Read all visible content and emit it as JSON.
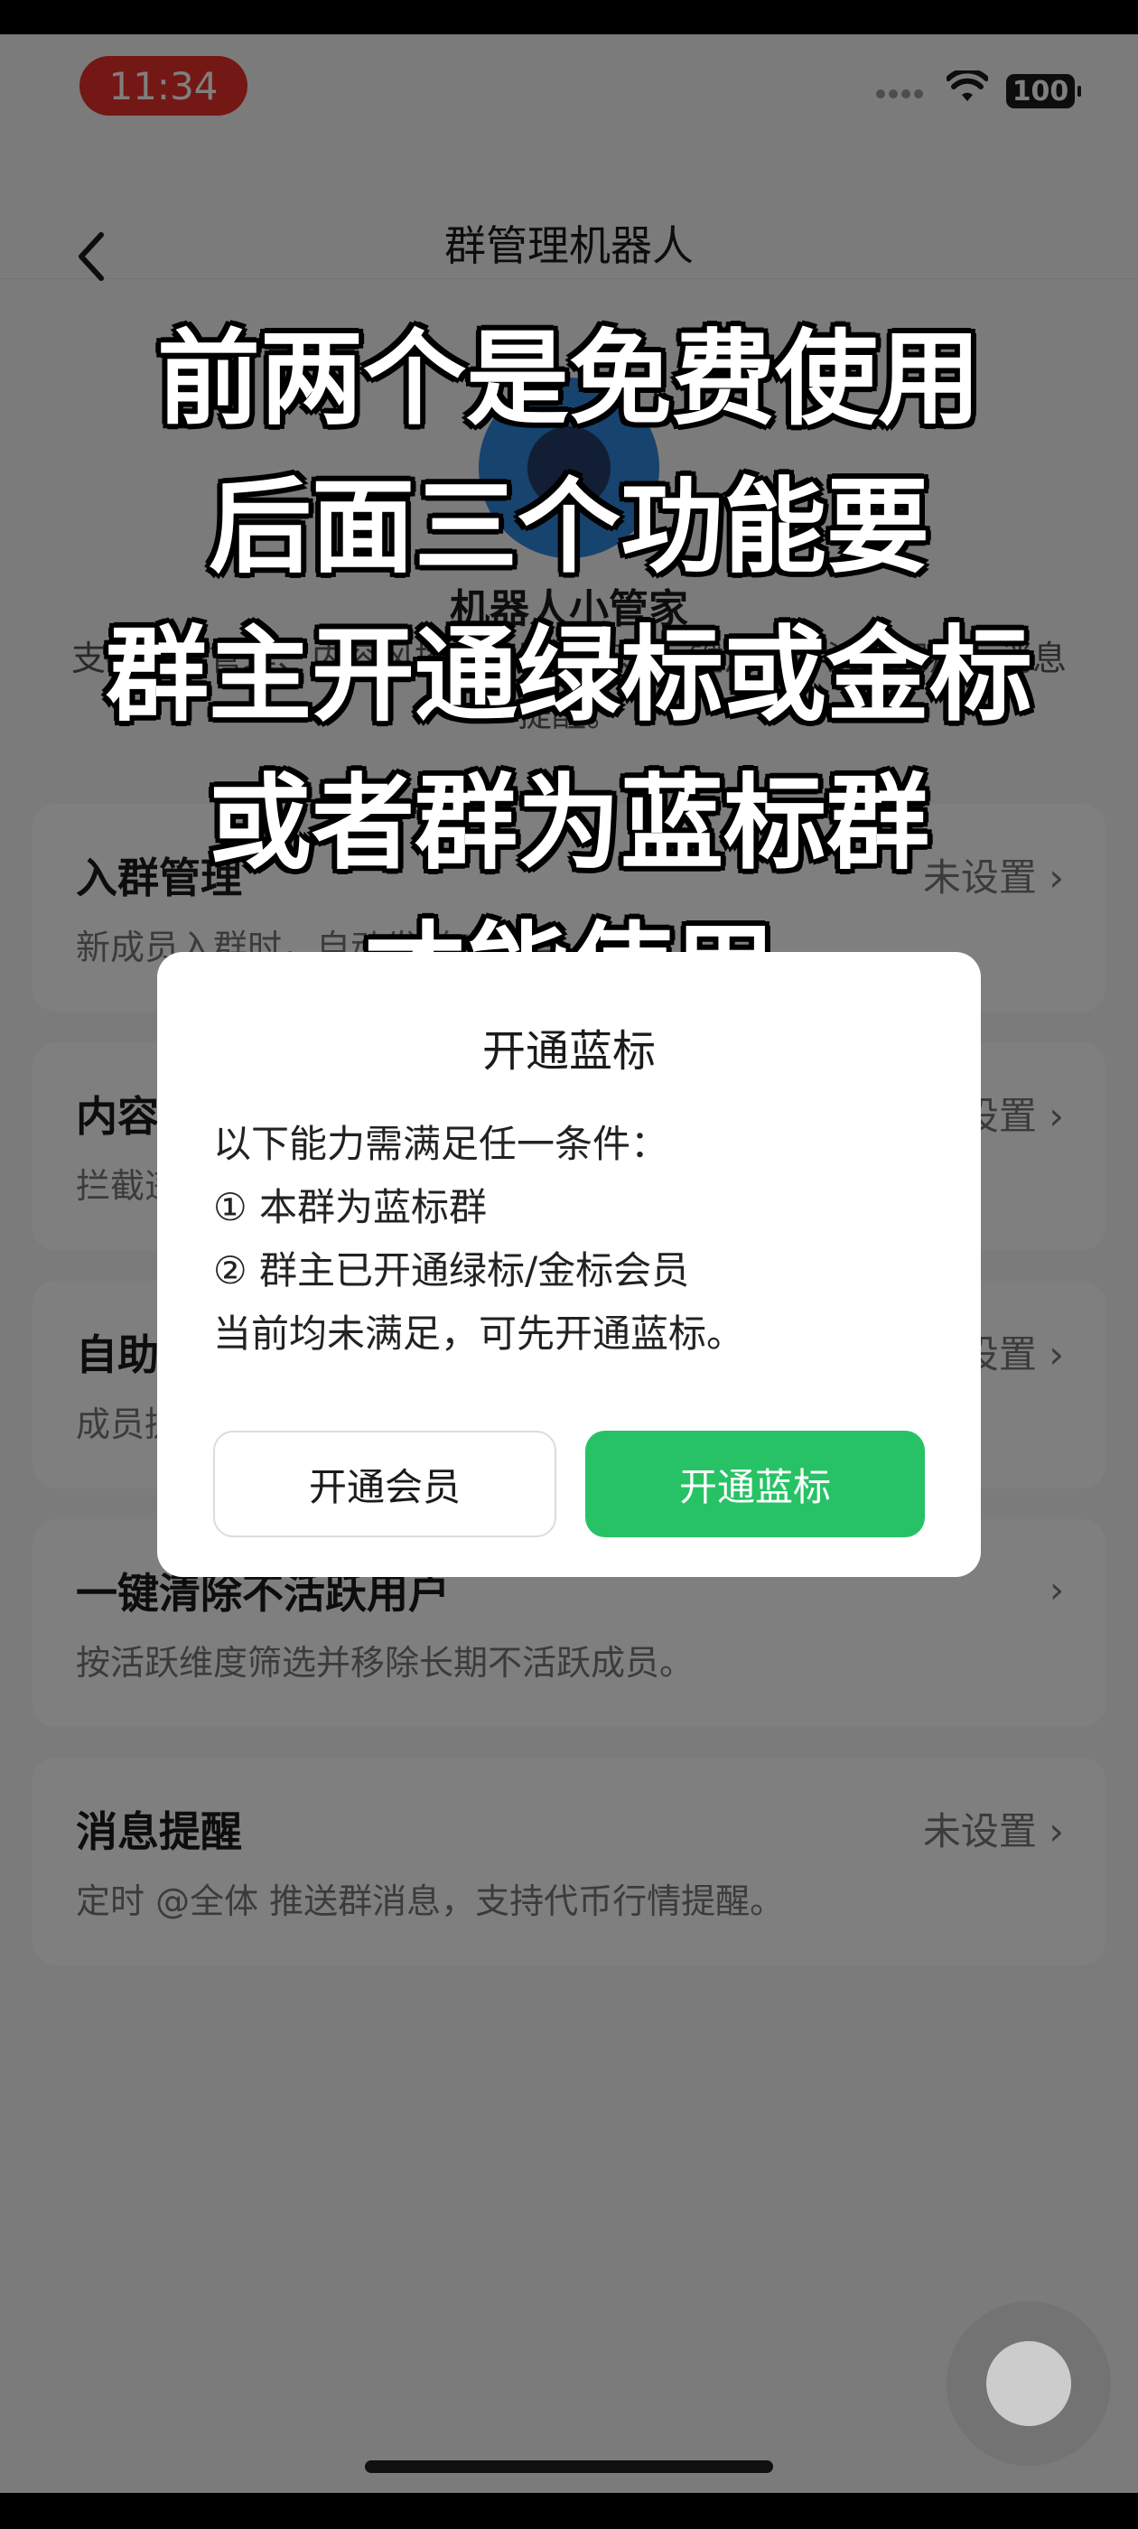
{
  "status_bar": {
    "time": "11:34",
    "battery": "100"
  },
  "nav": {
    "title": "群管理机器人"
  },
  "bot": {
    "name": "机器人小管家",
    "desc_line1": "支持入群管理、内容风控、自助问答、一键清除不活跃用户、消息",
    "desc_line2": "提醒。"
  },
  "cards": [
    {
      "title": "入群管理",
      "desc": "新成员入群时，自动发送欢迎语。",
      "status": "未设置",
      "chevron": "›"
    },
    {
      "title": "内容风控",
      "desc": "拦截违规消息。",
      "status": "未设置",
      "chevron": "›"
    },
    {
      "title": "自助问答",
      "desc": "成员提问时自动回复。",
      "status": "未设置",
      "chevron": "›"
    },
    {
      "title": "一键清除不活跃用户",
      "desc": "按活跃维度筛选并移除长期不活跃成员。",
      "status": "",
      "chevron": "›"
    },
    {
      "title": "消息提醒",
      "desc": "定时 @全体 推送群消息，支持代币行情提醒。",
      "status": "未设置",
      "chevron": "›"
    }
  ],
  "caption": {
    "lines": [
      "前两个是免费使用",
      "后面三个功能要",
      "群主开通绿标或金标",
      "或者群为蓝标群",
      "才能使用"
    ]
  },
  "dialog": {
    "title": "开通蓝标",
    "body": [
      "以下能力需满足任一条件：",
      "① 本群为蓝标群",
      "② 群主已开通绿标/金标会员",
      "当前均未满足，可先开通蓝标。"
    ],
    "member_button": "开通会员",
    "blue_button": "开通蓝标"
  },
  "colors": {
    "accent_green": "#27c265",
    "time_pill_red": "#e8302a"
  }
}
